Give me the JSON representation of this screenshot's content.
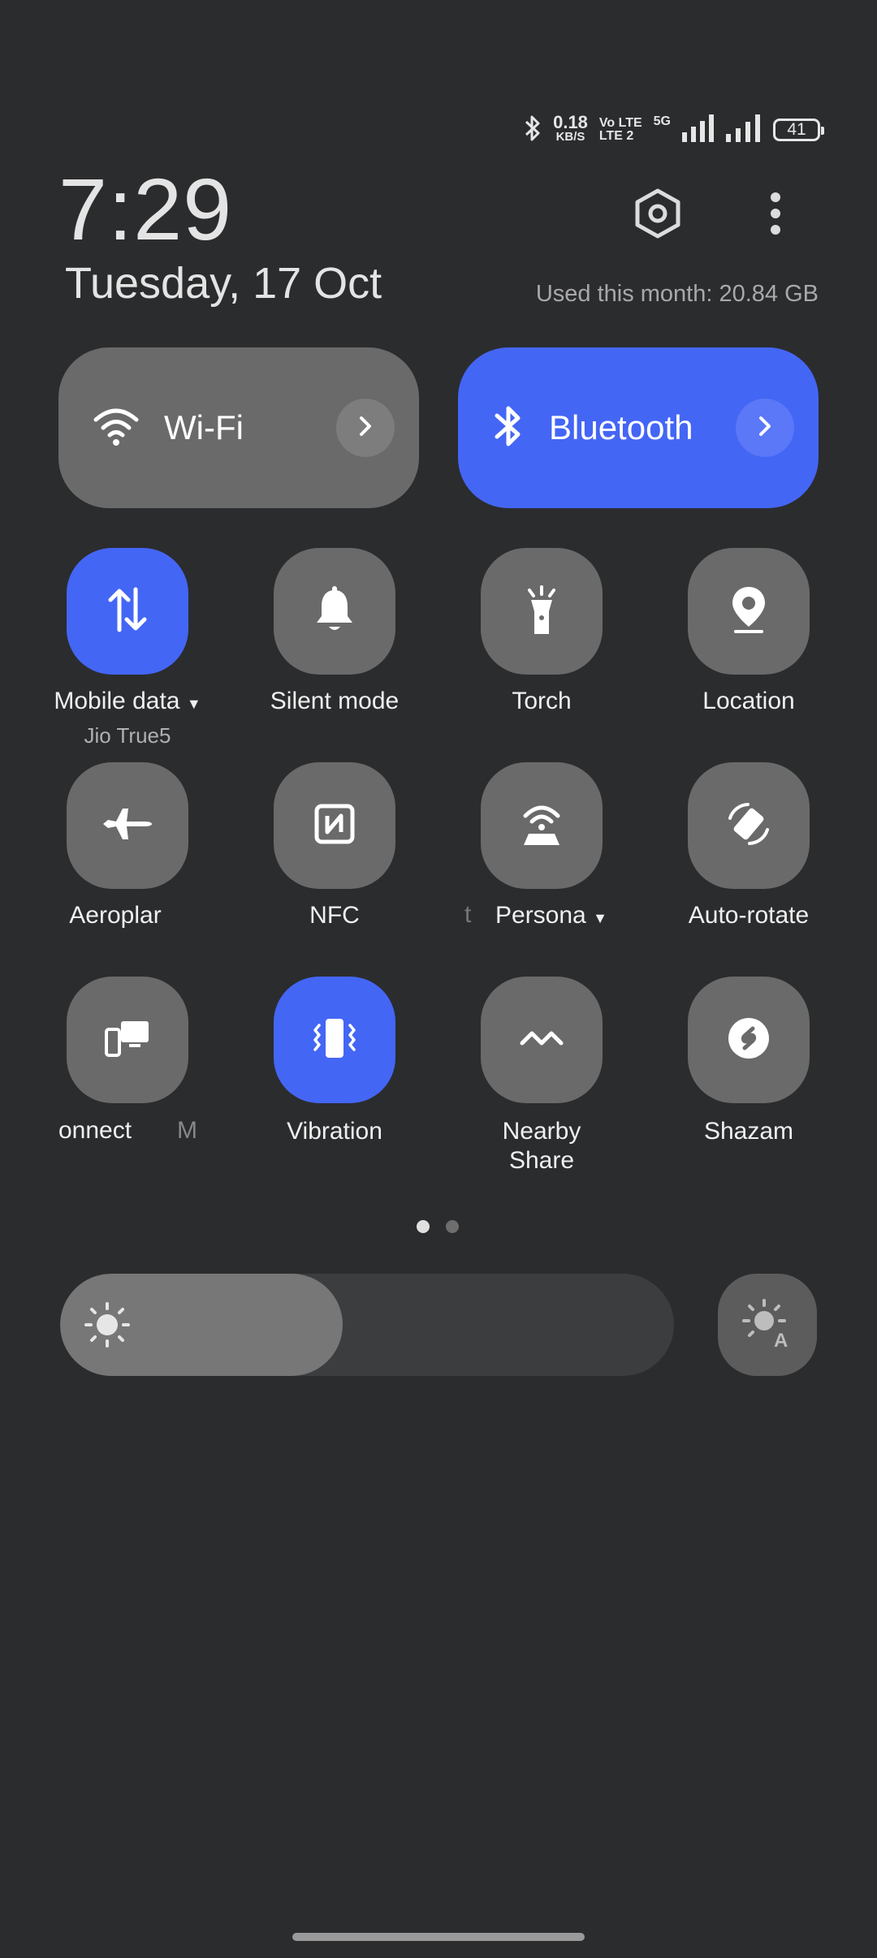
{
  "status_bar": {
    "speed_value": "0.18",
    "speed_unit": "KB/S",
    "volte_top": "Vo LTE",
    "volte_bottom": "LTE 2",
    "network": "5G",
    "battery": "41"
  },
  "header": {
    "time": "7:29",
    "date": "Tuesday, 17 Oct",
    "usage": "Used this month: 20.84 GB"
  },
  "big_tiles": {
    "wifi": {
      "label": "Wi-Fi",
      "active": false
    },
    "bluetooth": {
      "label": "Bluetooth",
      "active": true
    }
  },
  "tiles": [
    {
      "label": "Mobile data",
      "sub": "Jio True5",
      "active": true
    },
    {
      "label": "Silent mode",
      "active": false
    },
    {
      "label": "Torch",
      "active": false
    },
    {
      "label": "Location",
      "active": false
    },
    {
      "label": "Aeroplar",
      "active": false
    },
    {
      "label": "NFC",
      "active": false
    },
    {
      "label": "Persona",
      "prefix": "t",
      "active": false
    },
    {
      "label": "Auto-rotate",
      "active": false
    },
    {
      "label": "onnect",
      "suffix": "M",
      "active": false
    },
    {
      "label": "Vibration",
      "active": true
    },
    {
      "label": "Nearby Share",
      "active": false
    },
    {
      "label": "Shazam",
      "active": false
    }
  ],
  "pager": {
    "current": 1,
    "total": 2
  },
  "brightness": {
    "level_fraction": 0.46
  },
  "colors": {
    "accent": "#4466f5",
    "tile_off": "#6a6a6a",
    "background": "#2b2c2e"
  }
}
